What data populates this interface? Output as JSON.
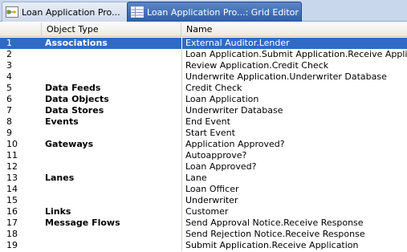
{
  "tabs": [
    {
      "label": "Loan Application Pro...",
      "icon": "process-diagram-icon",
      "active": false
    },
    {
      "label": "Loan Application Pro...: Grid Editor",
      "icon": "grid-editor-icon",
      "active": true
    }
  ],
  "colors": {
    "selection": "#316ac5",
    "active_tab": "#3f6cb3"
  },
  "grid": {
    "columns": [
      "",
      "Object Type",
      "Name"
    ],
    "selected_row": 1,
    "rows": [
      {
        "idx": "1",
        "type": "Associations",
        "name": "External Auditor.Lender"
      },
      {
        "idx": "2",
        "type": "",
        "name": "Loan Application.Submit Application.Receive Application"
      },
      {
        "idx": "3",
        "type": "",
        "name": "Review Application.Credit Check"
      },
      {
        "idx": "4",
        "type": "",
        "name": "Underwrite Application.Underwriter Database"
      },
      {
        "idx": "5",
        "type": "Data Feeds",
        "name": "Credit Check"
      },
      {
        "idx": "6",
        "type": "Data Objects",
        "name": "Loan Application"
      },
      {
        "idx": "7",
        "type": "Data Stores",
        "name": "Underwriter Database"
      },
      {
        "idx": "8",
        "type": "Events",
        "name": "End Event"
      },
      {
        "idx": "9",
        "type": "",
        "name": "Start Event"
      },
      {
        "idx": "10",
        "type": "Gateways",
        "name": "Application Approved?"
      },
      {
        "idx": "11",
        "type": "",
        "name": "Autoapprove?"
      },
      {
        "idx": "12",
        "type": "",
        "name": "Loan Approved?"
      },
      {
        "idx": "13",
        "type": "Lanes",
        "name": "Lane"
      },
      {
        "idx": "14",
        "type": "",
        "name": "Loan Officer"
      },
      {
        "idx": "15",
        "type": "",
        "name": "Underwriter"
      },
      {
        "idx": "16",
        "type": "Links",
        "name": "Customer"
      },
      {
        "idx": "17",
        "type": "Message Flows",
        "name": "Send Approval Notice.Receive Response"
      },
      {
        "idx": "18",
        "type": "",
        "name": "Send Rejection Notice.Receive Response"
      },
      {
        "idx": "19",
        "type": "",
        "name": "Submit Application.Receive Application"
      }
    ]
  }
}
